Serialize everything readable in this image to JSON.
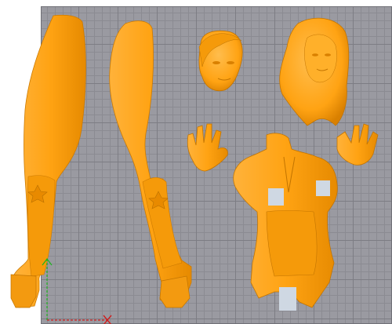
{
  "scene": {
    "background_color": "#ffffff",
    "build_plate_color": "#9a9aa1",
    "model_color": "#ffa313",
    "censor_color": "#cfd8e3",
    "axes": {
      "x_color": "#d01e1e",
      "y_color": "#1fb51f"
    }
  },
  "parts": [
    "left-leg",
    "right-leg",
    "short-hair-head",
    "long-hair-head",
    "left-hand",
    "right-hand",
    "torso"
  ]
}
